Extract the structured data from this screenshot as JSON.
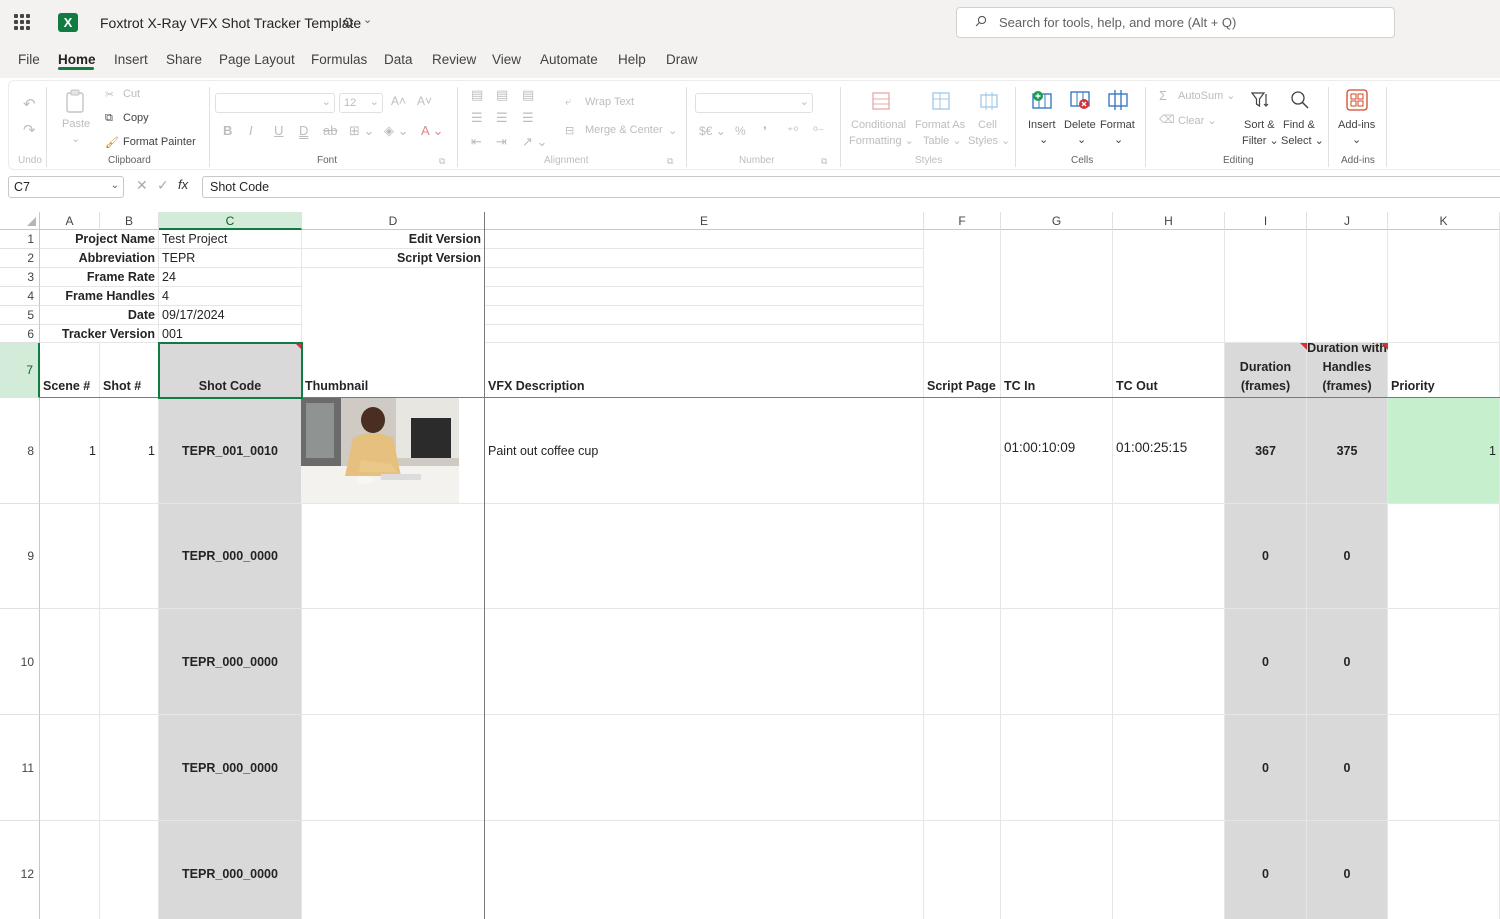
{
  "app": {
    "title": "Foxtrot X-Ray VFX Shot Tracker Template",
    "search_placeholder": "Search for tools, help, and more (Alt + Q)"
  },
  "menu": [
    "File",
    "Home",
    "Insert",
    "Share",
    "Page Layout",
    "Formulas",
    "Data",
    "Review",
    "View",
    "Automate",
    "Help",
    "Draw"
  ],
  "ribbon": {
    "undo_group": "Undo",
    "paste": "Paste",
    "cut": "Cut",
    "copy": "Copy",
    "format_painter": "Format Painter",
    "clipboard_group": "Clipboard",
    "font_size": "12",
    "font_group": "Font",
    "wrap_text": "Wrap Text",
    "merge_center": "Merge & Center",
    "alignment_group": "Alignment",
    "number_group": "Number",
    "currency_symbol": "$€",
    "percent_symbol": "%",
    "comma_symbol": "❜",
    "cond_format_1": "Conditional",
    "cond_format_2": "Formatting",
    "format_table_1": "Format As",
    "format_table_2": "Table",
    "cell_styles_1": "Cell",
    "cell_styles_2": "Styles",
    "styles_group": "Styles",
    "insert": "Insert",
    "delete": "Delete",
    "format": "Format",
    "cells_group": "Cells",
    "autosum": "AutoSum",
    "clear": "Clear",
    "sort_1": "Sort &",
    "sort_2": "Filter",
    "find_1": "Find &",
    "find_2": "Select",
    "editing_group": "Editing",
    "addins": "Add-ins",
    "addins_group": "Add-ins"
  },
  "formula_bar": {
    "name_box": "C7",
    "fx": "fx",
    "value": "Shot Code"
  },
  "columns": [
    "A",
    "B",
    "C",
    "D",
    "E",
    "F",
    "G",
    "H",
    "I",
    "J",
    "K"
  ],
  "rows": [
    "1",
    "2",
    "3",
    "4",
    "5",
    "6",
    "7",
    "8",
    "9",
    "10",
    "11",
    "12"
  ],
  "info": {
    "project_name_label": "Project Name",
    "project_name": "Test Project",
    "abbreviation_label": "Abbreviation",
    "abbreviation": "TEPR",
    "frame_rate_label": "Frame Rate",
    "frame_rate": "24",
    "frame_handles_label": "Frame Handles",
    "frame_handles": "4",
    "date_label": "Date",
    "date": "09/17/2024",
    "tracker_version_label": "Tracker Version",
    "tracker_version": "001",
    "edit_version_label": "Edit Version",
    "script_version_label": "Script Version"
  },
  "headers": {
    "scene": "Scene #",
    "shot": "Shot #",
    "shot_code": "Shot Code",
    "thumbnail": "Thumbnail",
    "vfx_description": "VFX Description",
    "script_page": "Script Page",
    "tc_in": "TC In",
    "tc_out": "TC Out",
    "duration": "Duration (frames)",
    "duration_handles": "Duration with Handles (frames)",
    "priority": "Priority"
  },
  "shots": [
    {
      "scene": "1",
      "shot": "1",
      "code": "TEPR_001_0010",
      "desc": "Paint out coffee cup",
      "tc_in": "01:00:10:09",
      "tc_out": "01:00:25:15",
      "duration": "367",
      "duration_handles": "375",
      "priority": "1"
    },
    {
      "scene": "",
      "shot": "",
      "code": "TEPR_000_0000",
      "desc": "",
      "tc_in": "",
      "tc_out": "",
      "duration": "0",
      "duration_handles": "0",
      "priority": ""
    },
    {
      "scene": "",
      "shot": "",
      "code": "TEPR_000_0000",
      "desc": "",
      "tc_in": "",
      "tc_out": "",
      "duration": "0",
      "duration_handles": "0",
      "priority": ""
    },
    {
      "scene": "",
      "shot": "",
      "code": "TEPR_000_0000",
      "desc": "",
      "tc_in": "",
      "tc_out": "",
      "duration": "0",
      "duration_handles": "0",
      "priority": ""
    },
    {
      "scene": "",
      "shot": "",
      "code": "TEPR_000_0000",
      "desc": "",
      "tc_in": "",
      "tc_out": "",
      "duration": "0",
      "duration_handles": "0",
      "priority": ""
    }
  ],
  "colors": {
    "accent": "#107c41",
    "selected_header": "#d3ecd9",
    "gray_fill": "#d9d9d9",
    "green_fill": "#c6efce"
  }
}
